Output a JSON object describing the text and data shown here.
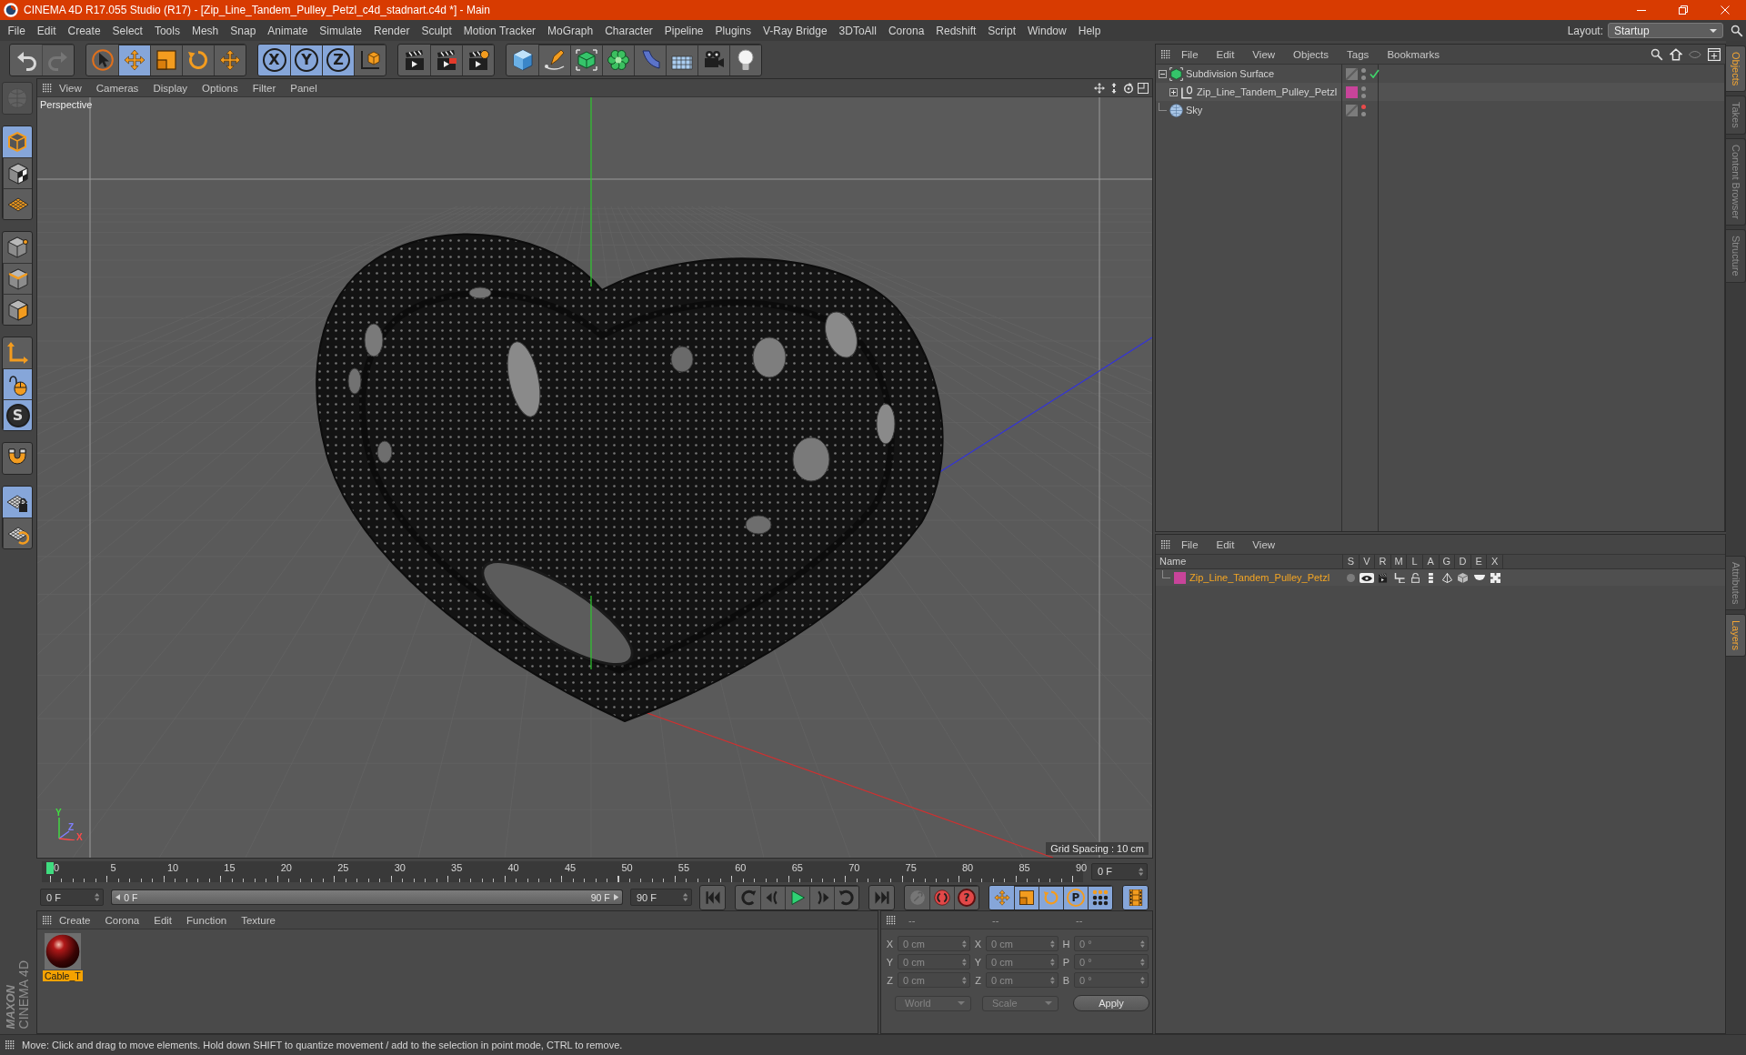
{
  "window": {
    "title": "CINEMA 4D R17.055 Studio (R17) - [Zip_Line_Tandem_Pulley_Petzl_c4d_stadnart.c4d *] - Main",
    "controls": [
      {
        "kind": "minimize"
      },
      {
        "kind": "restore"
      },
      {
        "kind": "close"
      }
    ]
  },
  "menu_bar": {
    "items": [
      "File",
      "Edit",
      "Create",
      "Select",
      "Tools",
      "Mesh",
      "Snap",
      "Animate",
      "Simulate",
      "Render",
      "Sculpt",
      "Motion Tracker",
      "MoGraph",
      "Character",
      "Pipeline",
      "Plugins",
      "V-Ray Bridge",
      "3DToAll",
      "Corona",
      "Redshift",
      "Script",
      "Window",
      "Help"
    ],
    "layout_label": "Layout:",
    "layout": "Startup"
  },
  "toolbar": {
    "groups": [
      [
        {
          "kind": "undo",
          "active": false,
          "disabled": false
        },
        {
          "kind": "redo",
          "active": false,
          "disabled": true
        }
      ],
      [
        {
          "kind": "select",
          "active": false,
          "disabled": false
        },
        {
          "kind": "move",
          "active": true,
          "disabled": false
        },
        {
          "kind": "scale",
          "active": false,
          "disabled": false
        },
        {
          "kind": "rotate",
          "active": false,
          "disabled": false
        },
        {
          "kind": "move",
          "active": false,
          "disabled": false
        }
      ],
      [
        {
          "kind": "axis",
          "label": "X",
          "active": true,
          "disabled": false
        },
        {
          "kind": "axis",
          "label": "Y",
          "active": true,
          "disabled": false
        },
        {
          "kind": "axis",
          "label": "Z",
          "active": true,
          "disabled": false
        },
        {
          "kind": "coords",
          "active": false,
          "disabled": false
        }
      ],
      [
        {
          "kind": "render_view",
          "active": false,
          "disabled": false
        },
        {
          "kind": "render_picture",
          "active": false,
          "disabled": false
        },
        {
          "kind": "render_settings",
          "active": false,
          "disabled": false
        }
      ],
      [
        {
          "kind": "cube",
          "active": false,
          "disabled": false
        },
        {
          "kind": "pen",
          "active": false,
          "disabled": false
        },
        {
          "kind": "subdivision",
          "active": false,
          "disabled": false
        },
        {
          "kind": "cloner",
          "active": false,
          "disabled": false
        },
        {
          "kind": "deformer",
          "active": false,
          "disabled": false
        },
        {
          "kind": "floor",
          "active": false,
          "disabled": false
        },
        {
          "kind": "camera",
          "active": false,
          "disabled": false
        },
        {
          "kind": "light",
          "active": false,
          "disabled": false
        }
      ]
    ]
  },
  "left_toolbar": {
    "groups": [
      [
        {
          "kind": "view_globe",
          "active": false,
          "disabled": true
        }
      ],
      [
        {
          "kind": "model",
          "active": true,
          "disabled": false
        },
        {
          "kind": "texture",
          "active": false,
          "disabled": false
        },
        {
          "kind": "workplane",
          "active": false,
          "disabled": false
        }
      ],
      [
        {
          "kind": "points",
          "active": false,
          "disabled": false
        },
        {
          "kind": "edges",
          "active": false,
          "disabled": false
        },
        {
          "kind": "polygons",
          "active": false,
          "disabled": false
        }
      ],
      [
        {
          "kind": "axis_mode",
          "active": false,
          "disabled": false
        },
        {
          "kind": "tweak",
          "active": true,
          "disabled": false
        },
        {
          "kind": "snap",
          "label": "S",
          "active": true,
          "disabled": false
        }
      ],
      [
        {
          "kind": "magnet",
          "active": false,
          "disabled": false
        }
      ],
      [
        {
          "kind": "grid_lock",
          "active": true,
          "disabled": false
        },
        {
          "kind": "grid_rotate",
          "active": false,
          "disabled": false
        }
      ]
    ]
  },
  "logo": {
    "brand": "MAXON",
    "product": "CINEMA 4D"
  },
  "viewport": {
    "menu": [
      "View",
      "Cameras",
      "Display",
      "Options",
      "Filter",
      "Panel"
    ],
    "nav": [
      {
        "kind": "pan"
      },
      {
        "kind": "zoom"
      },
      {
        "kind": "orbit"
      },
      {
        "kind": "maximize"
      }
    ],
    "camera": "Perspective",
    "grid_spacing": "Grid Spacing : 10 cm",
    "axis_labels": [
      "Y",
      "Z",
      "X"
    ]
  },
  "timeline": {
    "ticks": [
      "0",
      "5",
      "10",
      "15",
      "20",
      "25",
      "30",
      "35",
      "40",
      "45",
      "50",
      "55",
      "60",
      "65",
      "70",
      "75",
      "80",
      "85",
      "90"
    ],
    "level": 0,
    "frame": "0 F"
  },
  "playback": {
    "start": "0 F",
    "range": {
      "start": "0 F",
      "end": "90 F",
      "level": 1
    },
    "end": "90 F",
    "groups": [
      [
        {
          "kind": "go_start",
          "active": false,
          "disabled": false
        }
      ],
      [
        {
          "kind": "prev_key",
          "active": false,
          "disabled": false
        },
        {
          "kind": "prev_frame",
          "active": false,
          "disabled": false
        },
        {
          "kind": "play",
          "active": false,
          "disabled": false
        },
        {
          "kind": "next_frame",
          "active": false,
          "disabled": false
        },
        {
          "kind": "next_key",
          "active": false,
          "disabled": false
        }
      ],
      [
        {
          "kind": "go_end",
          "active": false,
          "disabled": false
        }
      ],
      [
        {
          "kind": "record",
          "active": false,
          "disabled": true
        },
        {
          "kind": "autokey",
          "active": false,
          "disabled": false
        },
        {
          "kind": "key_select",
          "label": "?",
          "active": false,
          "disabled": false
        }
      ],
      [
        {
          "kind": "key_move",
          "active": true,
          "disabled": false
        },
        {
          "kind": "key_scale",
          "active": true,
          "disabled": false
        },
        {
          "kind": "key_rotate",
          "active": true,
          "disabled": false
        },
        {
          "kind": "key_param",
          "label": "P",
          "active": true,
          "disabled": false
        },
        {
          "kind": "key_pla",
          "active": true,
          "disabled": false
        }
      ],
      [
        {
          "kind": "timeline",
          "active": true,
          "disabled": false
        }
      ]
    ]
  },
  "materials": {
    "menu": [
      "Create",
      "Corona",
      "Edit",
      "Function",
      "Texture"
    ],
    "items": [
      {
        "name": "Cable_T",
        "selected": true
      }
    ]
  },
  "coordinates": {
    "headers": [
      "--",
      "--",
      "--"
    ],
    "rows": [
      {
        "position_axis": "X",
        "position": "0 cm",
        "size_axis": "X",
        "size": "0 cm",
        "rotation_axis": "H",
        "rotation": "0 °"
      },
      {
        "position_axis": "Y",
        "position": "0 cm",
        "size_axis": "Y",
        "size": "0 cm",
        "rotation_axis": "P",
        "rotation": "0 °"
      },
      {
        "position_axis": "Z",
        "position": "0 cm",
        "size_axis": "Z",
        "size": "0 cm",
        "rotation_axis": "B",
        "rotation": "0 °"
      }
    ],
    "coord_system": "World",
    "size_mode": "Scale",
    "apply": "Apply"
  },
  "status_bar": {
    "text": "Move: Click and drag to move elements. Hold down SHIFT to quantize movement / add to the selection in point mode, CTRL to remove."
  },
  "objects_panel": {
    "menu": [
      "File",
      "Edit",
      "View",
      "Objects",
      "Tags",
      "Bookmarks"
    ],
    "tools": [
      {
        "kind": "search"
      },
      {
        "kind": "home"
      },
      {
        "kind": "eye"
      },
      {
        "kind": "new_panel"
      }
    ],
    "tree": [
      {
        "kind": "subdivision",
        "name": "Subdivision Surface",
        "expanded": true,
        "editor_hidden": false,
        "enabled": true,
        "children": [
          {
            "kind": "null",
            "name": "Zip_Line_Tandem_Pulley_Petzl",
            "color": "#c8449a",
            "expanded": false,
            "editor_hidden": false
          }
        ]
      },
      {
        "kind": "sky",
        "name": "Sky",
        "editor_hidden": true
      }
    ]
  },
  "layers_panel": {
    "menu": [
      "File",
      "Edit",
      "View"
    ],
    "columns": [
      "Name",
      "S",
      "V",
      "R",
      "M",
      "L",
      "A",
      "G",
      "D",
      "E",
      "X"
    ],
    "layers": [
      {
        "name": "Zip_Line_Tandem_Pulley_Petzl",
        "color": "#c8449a",
        "selected": true,
        "flags": [
          {
            "kind": "solo",
            "on": false
          },
          {
            "kind": "view",
            "on": true
          },
          {
            "kind": "render",
            "on": true
          },
          {
            "kind": "manager",
            "on": true
          },
          {
            "kind": "lock",
            "on": true
          },
          {
            "kind": "animation",
            "on": true
          },
          {
            "kind": "generators",
            "on": true
          },
          {
            "kind": "deformers",
            "on": true
          },
          {
            "kind": "expressions",
            "on": true
          },
          {
            "kind": "xrefs",
            "on": true
          }
        ]
      }
    ]
  },
  "side_tabs": {
    "top": [
      {
        "label": "Objects",
        "selected": true
      },
      {
        "label": "Takes",
        "selected": false
      },
      {
        "label": "Content Browser",
        "selected": false
      },
      {
        "label": "Structure",
        "selected": false
      }
    ],
    "bottom": [
      {
        "label": "Attributes",
        "selected": false
      },
      {
        "label": "Layers",
        "selected": true
      }
    ]
  }
}
